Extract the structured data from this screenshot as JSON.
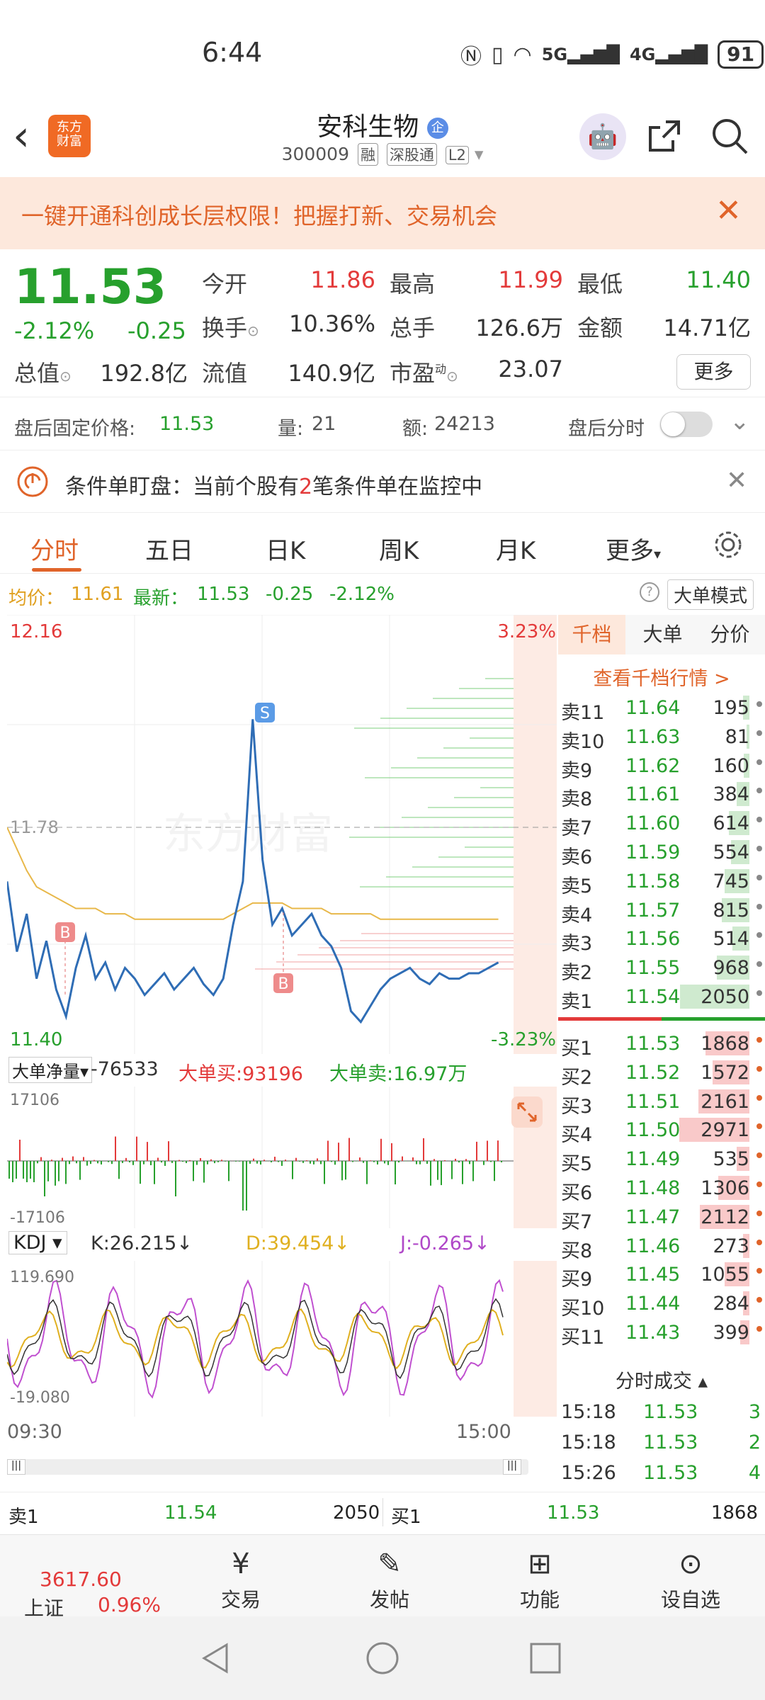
{
  "status": {
    "time": "6:44",
    "battery": "91",
    "sig5g": "5G",
    "sig4g": "4G"
  },
  "header": {
    "title": "安科生物",
    "title_badge": "企",
    "code": "300009",
    "tags": [
      "融",
      "深股通",
      "L2"
    ]
  },
  "banner": {
    "text": "一键开通科创成长层权限！把握打新、交易机会"
  },
  "quote": {
    "price": "11.53",
    "pct": "-2.12%",
    "chg": "-0.25",
    "jinkai_l": "今开",
    "jinkai": "11.86",
    "zuigao_l": "最高",
    "zuigao": "11.99",
    "zuidi_l": "最低",
    "zuidi": "11.40",
    "huanshou_l": "换手",
    "huanshou": "10.36%",
    "zongshou_l": "总手",
    "zongshou": "126.6万",
    "jine_l": "金额",
    "jine": "14.71亿",
    "zongzhi_l": "总值",
    "zongzhi": "192.8亿",
    "liuzhi_l": "流值",
    "liuzhi": "140.9亿",
    "shiying_l": "市盈",
    "shiying_sup": "动",
    "shiying": "23.07",
    "more": "更多"
  },
  "afterhours": {
    "price_label": "盘后固定价格:",
    "price": "11.53",
    "vol_label": "量:",
    "vol": "21",
    "amt_label": "额:",
    "amt": "24213",
    "fenshi": "盘后分时"
  },
  "condition": {
    "prefix": "条件单盯盘：当前个股有",
    "count": "2",
    "suffix": "笔条件单在监控中"
  },
  "tabs": [
    "分时",
    "五日",
    "日K",
    "周K",
    "月K",
    "更多"
  ],
  "infoline": {
    "avg_label": "均价：",
    "avg": "11.61",
    "last_label": "最新：",
    "last": "11.53",
    "chg": "-0.25",
    "pct": "-2.12%",
    "mode": "大单模式"
  },
  "chart": {
    "ymax": "12.16",
    "ymin": "11.40",
    "pmax": "3.23%",
    "pmin": "-3.23%",
    "ref": "11.78",
    "watermark": "东方财富",
    "net_label": "大单净量",
    "net": "-76533",
    "buy": "大单买:93196",
    "sell": "大单卖:16.97万",
    "vmax": "17106",
    "vmin": "-17106",
    "kdj_label": "KDJ",
    "k": "K:26.215↓",
    "d": "D:39.454↓",
    "j": "J:-0.265↓",
    "kmax": "119.690",
    "kmin": "-19.080",
    "t_start": "09:30",
    "t_end": "15:00",
    "marker_s": "S",
    "marker_b": "B",
    "price_series": [
      11.68,
      11.55,
      11.62,
      11.5,
      11.57,
      11.48,
      11.43,
      11.52,
      11.58,
      11.5,
      11.53,
      11.48,
      11.52,
      11.5,
      11.47,
      11.49,
      11.51,
      11.48,
      11.5,
      11.52,
      11.49,
      11.47,
      11.5,
      11.6,
      11.68,
      11.98,
      11.72,
      11.6,
      11.63,
      11.58,
      11.6,
      11.62,
      11.58,
      11.56,
      11.52,
      11.44,
      11.42,
      11.45,
      11.48,
      11.5,
      11.51,
      11.52,
      11.5,
      11.49,
      11.51,
      11.5,
      11.5,
      11.51,
      11.51,
      11.52,
      11.53
    ],
    "avg_series": [
      11.78,
      11.74,
      11.7,
      11.67,
      11.66,
      11.65,
      11.64,
      11.63,
      11.63,
      11.63,
      11.62,
      11.62,
      11.62,
      11.61,
      11.61,
      11.61,
      11.61,
      11.61,
      11.61,
      11.61,
      11.61,
      11.61,
      11.61,
      11.62,
      11.63,
      11.64,
      11.64,
      11.64,
      11.64,
      11.63,
      11.63,
      11.63,
      11.63,
      11.62,
      11.62,
      11.62,
      11.62,
      11.62,
      11.61,
      11.61,
      11.61,
      11.61,
      11.61,
      11.61,
      11.61,
      11.61,
      11.61,
      11.61,
      11.61,
      11.61,
      11.61
    ]
  },
  "book": {
    "tabs": [
      "千档",
      "大单",
      "分价"
    ],
    "link": "查看千档行情 >",
    "asks": [
      [
        "卖11",
        "11.64",
        "195"
      ],
      [
        "卖10",
        "11.63",
        "81"
      ],
      [
        "卖9",
        "11.62",
        "160"
      ],
      [
        "卖8",
        "11.61",
        "384"
      ],
      [
        "卖7",
        "11.60",
        "614"
      ],
      [
        "卖6",
        "11.59",
        "554"
      ],
      [
        "卖5",
        "11.58",
        "745"
      ],
      [
        "卖4",
        "11.57",
        "815"
      ],
      [
        "卖3",
        "11.56",
        "514"
      ],
      [
        "卖2",
        "11.55",
        "968"
      ],
      [
        "卖1",
        "11.54",
        "2050"
      ]
    ],
    "bids": [
      [
        "买1",
        "11.53",
        "1868"
      ],
      [
        "买2",
        "11.52",
        "1572"
      ],
      [
        "买3",
        "11.51",
        "2161"
      ],
      [
        "买4",
        "11.50",
        "2971"
      ],
      [
        "买5",
        "11.49",
        "535"
      ],
      [
        "买6",
        "11.48",
        "1306"
      ],
      [
        "买7",
        "11.47",
        "2112"
      ],
      [
        "买8",
        "11.46",
        "273"
      ],
      [
        "买9",
        "11.45",
        "1055"
      ],
      [
        "买10",
        "11.44",
        "284"
      ],
      [
        "买11",
        "11.43",
        "399"
      ]
    ],
    "trades_title": "分时成交",
    "trades": [
      [
        "15:18",
        "11.53",
        "3"
      ],
      [
        "15:18",
        "11.53",
        "2"
      ],
      [
        "15:26",
        "11.53",
        "4"
      ]
    ]
  },
  "bottom_quote": {
    "sell_l": "卖1",
    "sell_p": "11.54",
    "sell_v": "2050",
    "buy_l": "买1",
    "buy_p": "11.53",
    "buy_v": "1868"
  },
  "bottombar": {
    "index_val": "3617.60",
    "index_name": "上证",
    "index_pct": "0.96%",
    "trade": "交易",
    "post": "发帖",
    "func": "功能",
    "fav": "设自选"
  }
}
